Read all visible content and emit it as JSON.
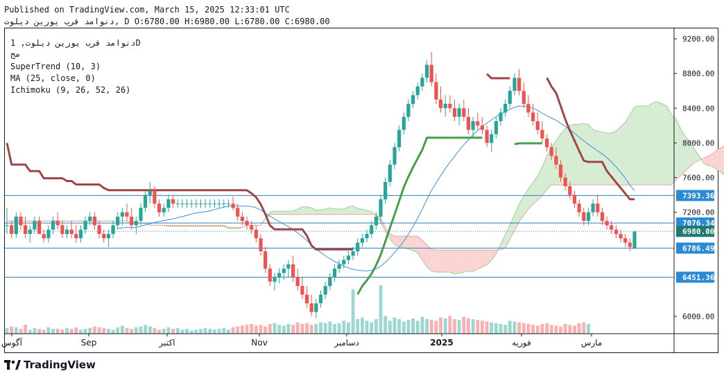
{
  "header": {
    "published": "Published on TradingView.com, March 15, 2025 12:33:01 UTC",
    "symbol_line": "دنوامد قرب یورین دیلوت, D O:6780.00 H:6980.00 L:6780.00 C:6980.00"
  },
  "legend": {
    "symbol": "دنوامد قرب یورین دیلوت, 1D",
    "line2": "مج",
    "supertrend": "SuperTrend (10, 3)",
    "ma": "MA (25, close, 0)",
    "ichimoku": "Ichimoku (9, 26, 52, 26)"
  },
  "footer": {
    "brand": "TradingView"
  },
  "colors": {
    "up": "#26a69a",
    "down": "#ef5350",
    "supertrend_up": "#43a047",
    "supertrend_down": "#a04545",
    "ma": "#3d8fd9",
    "kumo_bull": "#d6ecd3",
    "kumo_bear": "#fad4d2",
    "hline": "#2a7fb8",
    "price_tag": "#2a8ad4"
  },
  "chart_data": {
    "type": "candlestick",
    "y_axis": {
      "range": [
        5800,
        9320
      ],
      "ticks": [
        6000,
        7200,
        7600,
        8000,
        8400,
        8800,
        9200
      ],
      "tick_labels": [
        "6000.00",
        "7200.00",
        "7600.00",
        "8000.00",
        "8400.00",
        "8800.00",
        "9200.00"
      ],
      "position": "right"
    },
    "x_axis": {
      "labels": [
        "آگوس",
        "Sep",
        "اکتبر",
        "Nov",
        "دسامبر",
        "2025",
        "فوریه",
        "مارس"
      ]
    },
    "horizontal_levels": [
      {
        "value": 7393.36,
        "label": "7393.36"
      },
      {
        "value": 7076.34,
        "label": "7076.34"
      },
      {
        "value": 6786.49,
        "label": "6786.49"
      },
      {
        "value": 6451.36,
        "label": "6451.36"
      }
    ],
    "last_price": {
      "value": 6980.0,
      "label": "6980.00"
    },
    "candles": [
      [
        7050,
        7250,
        6950,
        7050
      ],
      [
        7050,
        7100,
        6900,
        6950
      ],
      [
        6950,
        7200,
        6900,
        7150
      ],
      [
        7150,
        7200,
        7000,
        7050
      ],
      [
        7050,
        7150,
        6900,
        6950
      ],
      [
        6950,
        7050,
        6850,
        7000
      ],
      [
        7000,
        7150,
        6950,
        7100
      ],
      [
        7100,
        7150,
        6950,
        6950
      ],
      [
        6950,
        7000,
        6850,
        6900
      ],
      [
        6900,
        7050,
        6850,
        7000
      ],
      [
        7000,
        7150,
        6950,
        7100
      ],
      [
        7100,
        7200,
        7000,
        7050
      ],
      [
        7050,
        7100,
        6900,
        6950
      ],
      [
        6950,
        7050,
        6900,
        7000
      ],
      [
        7000,
        7100,
        6900,
        6950
      ],
      [
        6950,
        7050,
        6850,
        6900
      ],
      [
        6900,
        7050,
        6850,
        7000
      ],
      [
        7000,
        7150,
        6950,
        7100
      ],
      [
        7100,
        7200,
        7050,
        7150
      ],
      [
        7150,
        7200,
        7000,
        7050
      ],
      [
        7050,
        7100,
        6900,
        6950
      ],
      [
        6950,
        7000,
        6850,
        6900
      ],
      [
        6900,
        7000,
        6800,
        6950
      ],
      [
        6950,
        7100,
        6900,
        7050
      ],
      [
        7050,
        7200,
        7000,
        7150
      ],
      [
        7150,
        7250,
        7050,
        7200
      ],
      [
        7200,
        7300,
        7100,
        7150
      ],
      [
        7150,
        7250,
        7000,
        7050
      ],
      [
        7050,
        7150,
        6950,
        7100
      ],
      [
        7100,
        7300,
        7050,
        7250
      ],
      [
        7250,
        7450,
        7200,
        7400
      ],
      [
        7400,
        7550,
        7300,
        7450
      ],
      [
        7450,
        7500,
        7250,
        7300
      ],
      [
        7300,
        7350,
        7150,
        7200
      ],
      [
        7200,
        7300,
        7150,
        7250
      ],
      [
        7250,
        7400,
        7200,
        7350
      ],
      [
        7350,
        7400,
        7250,
        7300
      ],
      [
        7300,
        7350,
        7250,
        7300
      ],
      [
        7300,
        7350,
        7250,
        7300
      ],
      [
        7300,
        7350,
        7250,
        7300
      ],
      [
        7300,
        7350,
        7250,
        7300
      ],
      [
        7300,
        7350,
        7250,
        7300
      ],
      [
        7300,
        7350,
        7250,
        7300
      ],
      [
        7300,
        7350,
        7250,
        7300
      ],
      [
        7300,
        7350,
        7250,
        7300
      ],
      [
        7300,
        7350,
        7250,
        7300
      ],
      [
        7300,
        7350,
        7250,
        7300
      ],
      [
        7300,
        7350,
        7250,
        7300
      ],
      [
        7300,
        7350,
        7250,
        7300
      ],
      [
        7300,
        7380,
        7220,
        7250
      ],
      [
        7250,
        7300,
        7100,
        7150
      ],
      [
        7150,
        7200,
        7050,
        7100
      ],
      [
        7100,
        7150,
        7000,
        7050
      ],
      [
        7050,
        7100,
        6950,
        7000
      ],
      [
        7000,
        7050,
        6850,
        6900
      ],
      [
        6900,
        6950,
        6700,
        6750
      ],
      [
        6750,
        6800,
        6500,
        6550
      ],
      [
        6550,
        6600,
        6350,
        6400
      ],
      [
        6400,
        6500,
        6300,
        6450
      ],
      [
        6450,
        6550,
        6380,
        6500
      ],
      [
        6500,
        6600,
        6420,
        6550
      ],
      [
        6550,
        6650,
        6450,
        6600
      ],
      [
        6600,
        6700,
        6400,
        6450
      ],
      [
        6450,
        6550,
        6300,
        6350
      ],
      [
        6350,
        6450,
        6200,
        6250
      ],
      [
        6250,
        6350,
        6100,
        6150
      ],
      [
        6150,
        6250,
        6000,
        6050
      ],
      [
        6050,
        6200,
        5980,
        6150
      ],
      [
        6150,
        6300,
        6100,
        6250
      ],
      [
        6250,
        6400,
        6200,
        6350
      ],
      [
        6350,
        6500,
        6300,
        6450
      ],
      [
        6450,
        6600,
        6400,
        6550
      ],
      [
        6550,
        6650,
        6500,
        6600
      ],
      [
        6600,
        6700,
        6550,
        6650
      ],
      [
        6650,
        6750,
        6600,
        6700
      ],
      [
        6700,
        6800,
        6650,
        6750
      ],
      [
        6750,
        6900,
        6700,
        6850
      ],
      [
        6850,
        6950,
        6800,
        6900
      ],
      [
        6900,
        7000,
        6850,
        6950
      ],
      [
        6950,
        7100,
        6900,
        7050
      ],
      [
        7050,
        7200,
        7000,
        7150
      ],
      [
        7150,
        7400,
        7100,
        7350
      ],
      [
        7350,
        7600,
        7300,
        7550
      ],
      [
        7550,
        7800,
        7500,
        7750
      ],
      [
        7750,
        8000,
        7700,
        7950
      ],
      [
        7950,
        8200,
        7900,
        8150
      ],
      [
        8150,
        8350,
        8100,
        8300
      ],
      [
        8300,
        8500,
        8250,
        8450
      ],
      [
        8450,
        8600,
        8400,
        8550
      ],
      [
        8550,
        8700,
        8500,
        8650
      ],
      [
        8650,
        8800,
        8600,
        8750
      ],
      [
        8750,
        8950,
        8700,
        8900
      ],
      [
        8900,
        9050,
        8650,
        8700
      ],
      [
        8700,
        8800,
        8450,
        8500
      ],
      [
        8500,
        8650,
        8350,
        8400
      ],
      [
        8400,
        8550,
        8300,
        8450
      ],
      [
        8450,
        8550,
        8350,
        8400
      ],
      [
        8400,
        8500,
        8250,
        8300
      ],
      [
        8300,
        8450,
        8200,
        8400
      ],
      [
        8400,
        8500,
        8250,
        8300
      ],
      [
        8300,
        8400,
        8100,
        8150
      ],
      [
        8150,
        8300,
        8050,
        8250
      ],
      [
        8250,
        8350,
        8150,
        8200
      ],
      [
        8200,
        8300,
        8100,
        8150
      ],
      [
        8150,
        8200,
        7950,
        8000
      ],
      [
        8000,
        8150,
        7900,
        8100
      ],
      [
        8100,
        8300,
        8050,
        8250
      ],
      [
        8250,
        8400,
        8200,
        8350
      ],
      [
        8350,
        8500,
        8300,
        8450
      ],
      [
        8450,
        8650,
        8400,
        8600
      ],
      [
        8600,
        8800,
        8550,
        8750
      ],
      [
        8750,
        8850,
        8550,
        8600
      ],
      [
        8600,
        8700,
        8400,
        8450
      ],
      [
        8450,
        8550,
        8300,
        8350
      ],
      [
        8350,
        8450,
        8200,
        8250
      ],
      [
        8250,
        8350,
        8100,
        8150
      ],
      [
        8150,
        8250,
        8000,
        8050
      ],
      [
        8050,
        8100,
        7900,
        7950
      ],
      [
        7950,
        8000,
        7800,
        7850
      ],
      [
        7850,
        7950,
        7700,
        7750
      ],
      [
        7750,
        7800,
        7550,
        7600
      ],
      [
        7600,
        7650,
        7450,
        7500
      ],
      [
        7500,
        7550,
        7350,
        7400
      ],
      [
        7400,
        7450,
        7250,
        7300
      ],
      [
        7300,
        7350,
        7150,
        7200
      ],
      [
        7200,
        7250,
        7050,
        7100
      ],
      [
        7100,
        7250,
        7050,
        7200
      ],
      [
        7200,
        7350,
        7150,
        7300
      ],
      [
        7300,
        7400,
        7150,
        7200
      ],
      [
        7200,
        7250,
        7050,
        7100
      ],
      [
        7100,
        7150,
        7000,
        7050
      ],
      [
        7050,
        7100,
        6950,
        7000
      ],
      [
        7000,
        7050,
        6900,
        6950
      ],
      [
        6950,
        7000,
        6850,
        6900
      ],
      [
        6900,
        6950,
        6800,
        6850
      ],
      [
        6850,
        6900,
        6750,
        6800
      ],
      [
        6780,
        6980,
        6780,
        6980
      ]
    ],
    "volumes": [
      7,
      9,
      8,
      6,
      11,
      5,
      7,
      6,
      5,
      8,
      6,
      6,
      5,
      7,
      6,
      8,
      5,
      6,
      7,
      9,
      8,
      7,
      6,
      5,
      8,
      10,
      7,
      6,
      8,
      9,
      11,
      9,
      7,
      5,
      6,
      8,
      6,
      7,
      5,
      6,
      4,
      5,
      6,
      7,
      6,
      5,
      6,
      7,
      5,
      8,
      9,
      10,
      11,
      12,
      10,
      11,
      9,
      12,
      13,
      11,
      10,
      12,
      11,
      14,
      12,
      13,
      11,
      12,
      14,
      13,
      15,
      12,
      13,
      16,
      14,
      55,
      18,
      20,
      16,
      14,
      18,
      60,
      22,
      16,
      20,
      18,
      15,
      17,
      19,
      16,
      21,
      18,
      17,
      16,
      20,
      19,
      22,
      18,
      17,
      21,
      19,
      18,
      17,
      16,
      15,
      14,
      13,
      12,
      11,
      16,
      15,
      14,
      13,
      12,
      11,
      10,
      12,
      13,
      11,
      10,
      9,
      12,
      11,
      10,
      13,
      14,
      12
    ],
    "series": [
      {
        "name": "SuperTrend (10, 3)",
        "values": []
      },
      {
        "name": "MA (25, close, 0)",
        "values": []
      },
      {
        "name": "Ichimoku (9, 26, 52, 26)",
        "values": []
      }
    ]
  }
}
